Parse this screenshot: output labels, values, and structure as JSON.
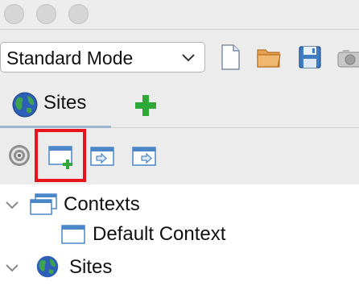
{
  "titlebar": {
    "buttons": [
      "close",
      "minimize",
      "zoom"
    ]
  },
  "toolbar": {
    "mode": "Standard Mode",
    "buttons": [
      {
        "name": "new-session-button",
        "icon": "new-document-icon"
      },
      {
        "name": "open-session-button",
        "icon": "folder-icon"
      },
      {
        "name": "save-session-button",
        "icon": "save-icon"
      },
      {
        "name": "snapshot-button",
        "icon": "camera-icon"
      }
    ]
  },
  "tabs": {
    "sites_label": "Sites",
    "add_icon": "plus-icon"
  },
  "subtools": [
    {
      "name": "target-button",
      "icon": "target-icon"
    },
    {
      "name": "new-context-button",
      "icon": "window-add-icon",
      "highlighted": true
    },
    {
      "name": "import-context-button",
      "icon": "window-import-icon"
    },
    {
      "name": "export-context-button",
      "icon": "window-export-icon"
    }
  ],
  "tree": {
    "contexts_label": "Contexts",
    "default_context_label": "Default Context",
    "sites_label": "Sites"
  },
  "colors": {
    "highlight": "#e8141c",
    "tab_underline": "#9eb6cf",
    "plus_green": "#2fa83a"
  }
}
